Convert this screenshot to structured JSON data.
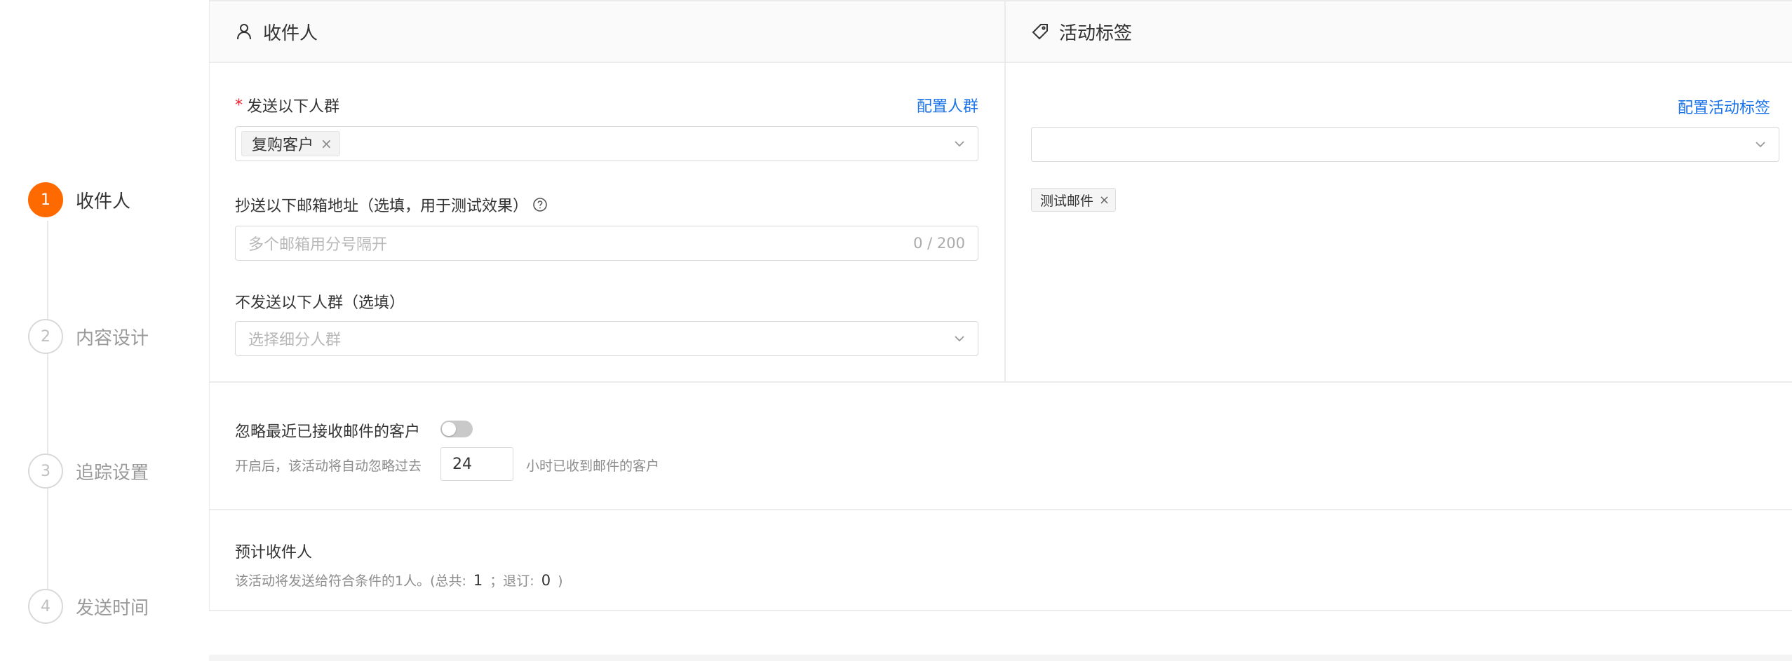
{
  "steps": [
    {
      "num": "1",
      "label": "收件人",
      "active": true
    },
    {
      "num": "2",
      "label": "内容设计",
      "active": false
    },
    {
      "num": "3",
      "label": "追踪设置",
      "active": false
    },
    {
      "num": "4",
      "label": "发送时间",
      "active": false
    }
  ],
  "recipients": {
    "header_title": "收件人",
    "send_label": "发送以下人群",
    "config_link": "配置人群",
    "selected_tag": "复购客户",
    "cc_label": "抄送以下邮箱地址（选填，用于测试效果）",
    "cc_placeholder": "多个邮箱用分号隔开",
    "cc_counter": "0 / 200",
    "exclude_label": "不发送以下人群（选填）",
    "exclude_placeholder": "选择细分人群"
  },
  "activity_tags": {
    "header_title": "活动标签",
    "config_link": "配置活动标签",
    "tag": "测试邮件"
  },
  "ignore": {
    "label": "忽略最近已接收邮件的客户",
    "toggle_on": false,
    "hint_before": "开启后，该活动将自动忽略过去",
    "hours": "24",
    "hint_after": "小时已收到邮件的客户"
  },
  "estimate": {
    "title": "预计收件人",
    "text": "该活动将发送给符合条件的1人。(总共:",
    "total": "1",
    "sep": "；退订:",
    "unsubscribed": "0",
    "close": ")"
  },
  "colors": {
    "accent": "#ff6a00",
    "link": "#1a73e8",
    "required": "#f5222d"
  }
}
